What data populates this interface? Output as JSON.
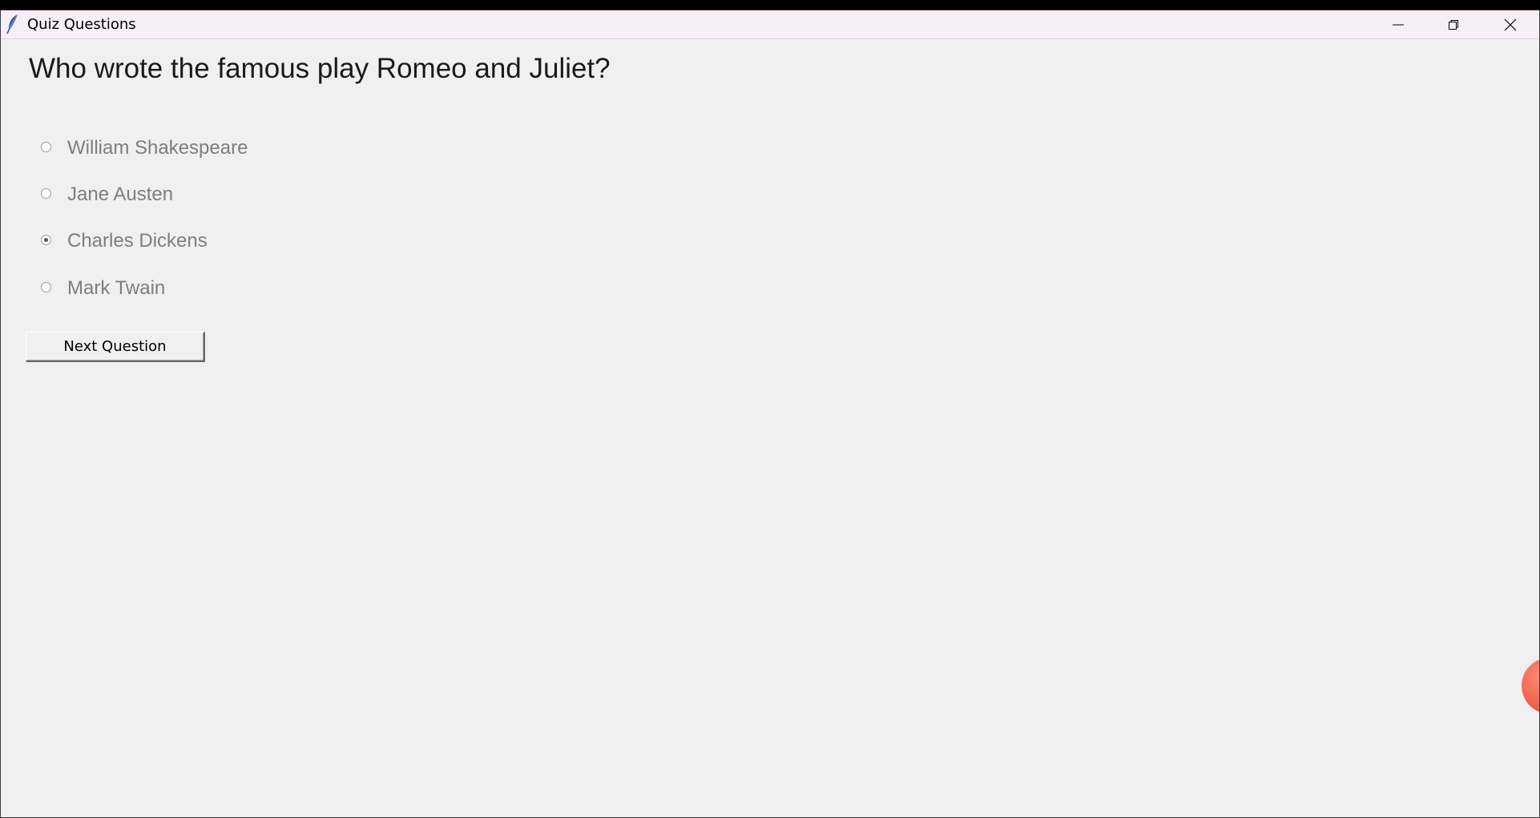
{
  "window": {
    "title": "Quiz Questions",
    "app_icon": "feather-icon"
  },
  "quiz": {
    "question": "Who wrote the famous play Romeo and Juliet?",
    "options": [
      {
        "label": "William Shakespeare",
        "selected": false
      },
      {
        "label": "Jane Austen",
        "selected": false
      },
      {
        "label": "Charles Dickens",
        "selected": true
      },
      {
        "label": "Mark Twain",
        "selected": false
      }
    ],
    "next_label": "Next Question"
  },
  "colors": {
    "window_bg": "#f0f0f0",
    "titlebar_bg": "#f7eef6",
    "option_text": "#7e7e7e"
  }
}
